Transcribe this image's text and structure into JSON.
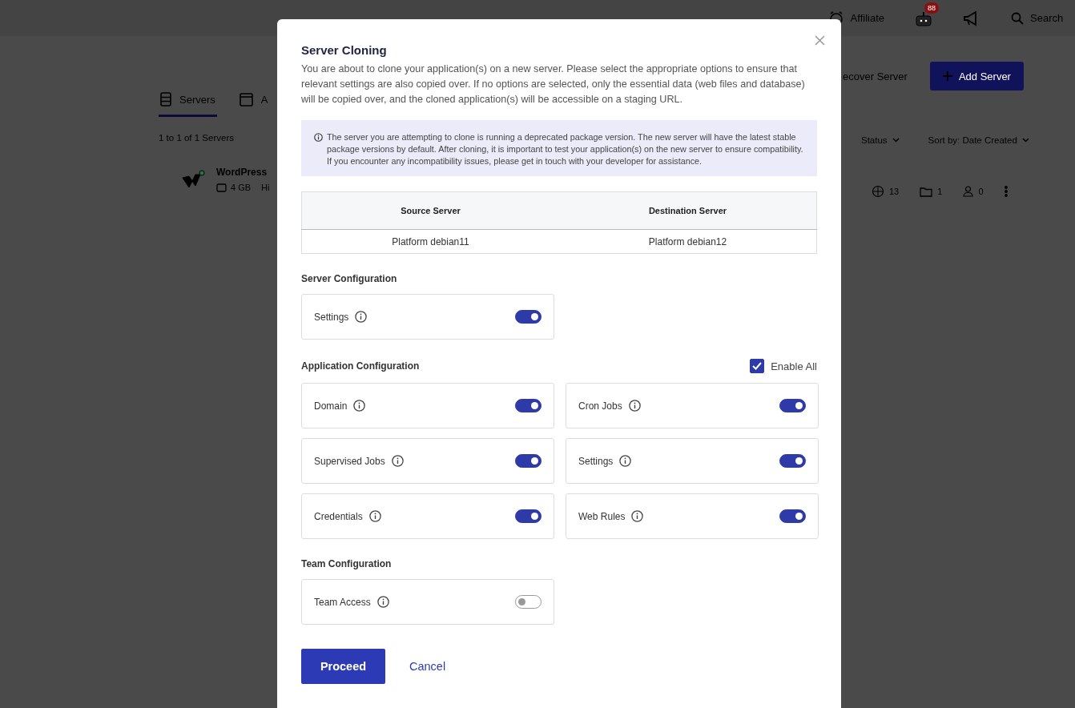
{
  "topbar": {
    "affiliate": "Affiliate",
    "notification_badge": "88",
    "search": {
      "placeholder": "Search"
    }
  },
  "tabs": [
    {
      "label": "Servers",
      "selected": true
    },
    {
      "label": "A",
      "selected": false
    }
  ],
  "server_count": "1 to 1 of 1 Servers",
  "server": {
    "name": "WordPress",
    "ram": "4 GB",
    "plan": "Hi",
    "websites": "13",
    "folders": "1",
    "members": "0"
  },
  "actions": {
    "recover": "ecover Server",
    "add": "Add Server"
  },
  "filters": {
    "status": "Status",
    "sort": "Sort by: Date Created"
  },
  "modal": {
    "title": "Server Cloning",
    "description": "You are about to clone your application(s) on a new server. Please select the appropriate options to ensure that relevant settings are also copied over. If no options are selected, only the essential data (web files and database) will be copied over, and the cloned application(s) will be accessible on a staging URL.",
    "notice": "The server you are attempting to clone is running a deprecated package version. The new server will have the latest stable package versions by default. After cloning, it is important to test your application(s) on the new server to ensure compatibility. If you encounter any incompatibility issues, please get in touch with your developer for assistance.",
    "table": {
      "columns": [
        "Source Server",
        "Destination Server"
      ],
      "rows": [
        [
          "Platform debian11",
          "Platform debian12"
        ]
      ]
    },
    "sections": [
      {
        "title": "Server Configuration",
        "options": [
          {
            "label": "Settings",
            "on": true
          }
        ]
      },
      {
        "title": "Application Configuration",
        "enable_all": {
          "label": "Enable All",
          "checked": true
        },
        "options": [
          {
            "label": "Domain",
            "on": true
          },
          {
            "label": "Cron Jobs",
            "on": true
          },
          {
            "label": "Supervised Jobs",
            "on": true
          },
          {
            "label": "Settings",
            "on": true
          },
          {
            "label": "Credentials",
            "on": true
          },
          {
            "label": "Web Rules",
            "on": true
          }
        ]
      },
      {
        "title": "Team Configuration",
        "options": [
          {
            "label": "Team Access",
            "on": false
          }
        ]
      }
    ],
    "buttons": {
      "proceed": "Proceed",
      "cancel": "Cancel"
    }
  }
}
